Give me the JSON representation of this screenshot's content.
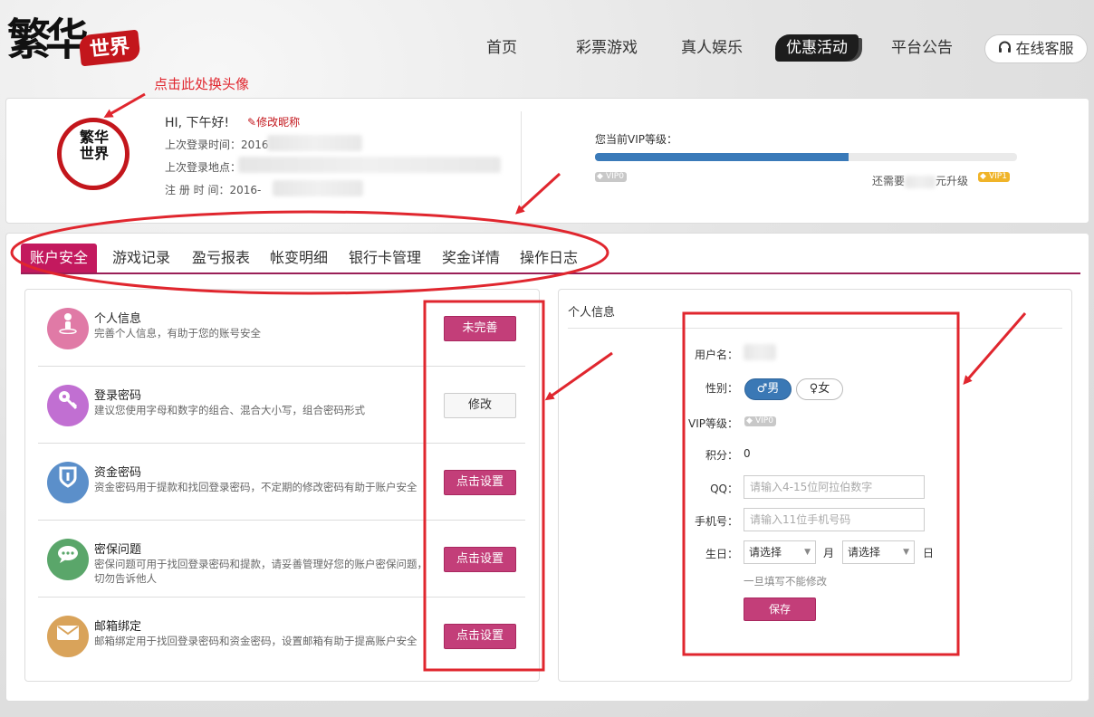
{
  "brand": {
    "logo_text": "繁华",
    "logo_seal": "世界"
  },
  "nav": {
    "items": [
      {
        "label": "首页",
        "active": false
      },
      {
        "label": "彩票游戏",
        "active": false
      },
      {
        "label": "真人娱乐",
        "active": false
      },
      {
        "label": "优惠活动",
        "active": true
      },
      {
        "label": "平台公告",
        "active": false
      }
    ],
    "service_label": "在线客服",
    "service_icon": "headphones-icon"
  },
  "annotation": {
    "avatar_hint": "点击此处换头像",
    "color": "#e0262e"
  },
  "profile": {
    "avatar_text": "繁华世界",
    "greeting": "HI, 下午好!",
    "edit_nickname": "修改昵称",
    "last_login_time_label": "上次登录时间：2016",
    "last_login_place_label": "上次登录地点：",
    "register_time_label": "注 册 时 间：2016-",
    "vip": {
      "label": "您当前VIP等级：",
      "progress": 0.6,
      "current_level": "VIP0",
      "next_level": "VIP1",
      "need_prefix": "还需要",
      "need_suffix": "元升级"
    }
  },
  "tabs": [
    {
      "label": "账户安全",
      "active": true
    },
    {
      "label": "游戏记录",
      "active": false
    },
    {
      "label": "盈亏报表",
      "active": false
    },
    {
      "label": "帐变明细",
      "active": false
    },
    {
      "label": "银行卡管理",
      "active": false
    },
    {
      "label": "奖金详情",
      "active": false
    },
    {
      "label": "操作日志",
      "active": false
    }
  ],
  "security": {
    "items": [
      {
        "icon": "user-icon",
        "color": "#e07aa6",
        "title": "个人信息",
        "desc": "完善个人信息，有助于您的账号安全",
        "button": "未完善",
        "button_style": "pink"
      },
      {
        "icon": "key-icon",
        "color": "#c16fd2",
        "title": "登录密码",
        "desc": "建议您使用字母和数字的组合、混合大小写，组合密码形式",
        "button": "修改",
        "button_style": "plain"
      },
      {
        "icon": "shield-icon",
        "color": "#5b8fca",
        "title": "资金密码",
        "desc": "资金密码用于提款和找回登录密码，不定期的修改密码有助于账户安全",
        "button": "点击设置",
        "button_style": "pink"
      },
      {
        "icon": "chat-icon",
        "color": "#5aa66a",
        "title": "密保问题",
        "desc": "密保问题可用于找回登录密码和提款，请妥善管理好您的账户密保问题，切勿告诉他人",
        "button": "点击设置",
        "button_style": "pink"
      },
      {
        "icon": "mail-icon",
        "color": "#d9a35a",
        "title": "邮箱绑定",
        "desc": "邮箱绑定用于找回登录密码和资金密码，设置邮箱有助于提高账户安全",
        "button": "点击设置",
        "button_style": "pink"
      }
    ]
  },
  "personal_info": {
    "title": "个人信息",
    "username_label": "用户名：",
    "gender_label": "性别：",
    "gender_male": "♂男",
    "gender_female": "♀女",
    "vip_label": "VIP等级：",
    "vip_value": "VIP0",
    "points_label": "积分：",
    "points_value": "0",
    "qq_label": "QQ：",
    "qq_placeholder": "请输入4-15位阿拉伯数字",
    "phone_label": "手机号：",
    "phone_placeholder": "请输入11位手机号码",
    "birthday_label": "生日：",
    "month_select": "请选择",
    "month_unit": "月",
    "day_select": "请选择",
    "day_unit": "日",
    "note": "一旦填写不能修改",
    "save": "保存"
  }
}
